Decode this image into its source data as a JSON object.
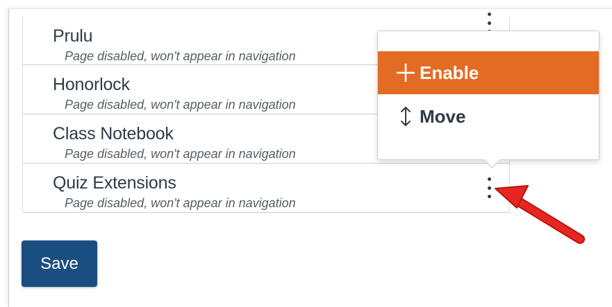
{
  "nav_items": [
    {
      "title": "Prulu",
      "subtitle": "Page disabled, won't appear in navigation"
    },
    {
      "title": "Honorlock",
      "subtitle": "Page disabled, won't appear in navigation"
    },
    {
      "title": "Class Notebook",
      "subtitle": "Page disabled, won't appear in navigation"
    },
    {
      "title": "Quiz Extensions",
      "subtitle": "Page disabled, won't appear in navigation"
    }
  ],
  "menu": {
    "enable_label": "Enable",
    "enable_icon": "plus-icon",
    "move_label": "Move",
    "move_icon": "up-down-arrow-icon"
  },
  "save_label": "Save",
  "colors": {
    "enable_bg": "#e46b24",
    "save_bg": "#1b4e80",
    "annotation_arrow": "#e8261f"
  }
}
